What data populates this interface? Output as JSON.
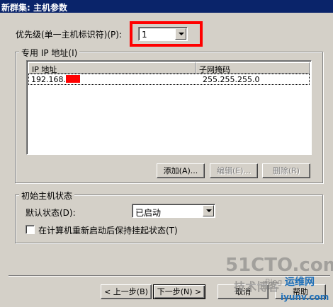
{
  "window": {
    "title": "新群集: 主机参数"
  },
  "priority": {
    "label": "优先级(单一主机标识符)(P):",
    "value": "1"
  },
  "dedicated_ip_group": {
    "title": "专用 IP 地址(I)",
    "columns": [
      "IP 地址",
      "子网掩码"
    ],
    "rows": [
      {
        "ip": "192.168.",
        "mask": "255.255.255.0"
      }
    ],
    "buttons": {
      "add": "添加(A)...",
      "edit": "编辑(E)...",
      "delete": "删除(R)"
    }
  },
  "initial_state_group": {
    "title": "初始主机状态",
    "default_state_label": "默认状态(D):",
    "default_state_value": "已启动",
    "retain_suspended_label": "在计算机重新启动后保持挂起状态(T)"
  },
  "footer": {
    "back": "< 上一步(B)",
    "next": "下一步(N) >",
    "cancel": "取消",
    "help": "帮助"
  },
  "watermark": {
    "site": "51CTO.com",
    "blog": "技术博客",
    "brand": "运维网",
    "domain": "iyunv.com",
    "blog_short": "Blog"
  },
  "colors": {
    "titlebar": "#0a246a",
    "highlight": "#ff0000",
    "dialog": "#d4d0c8"
  }
}
